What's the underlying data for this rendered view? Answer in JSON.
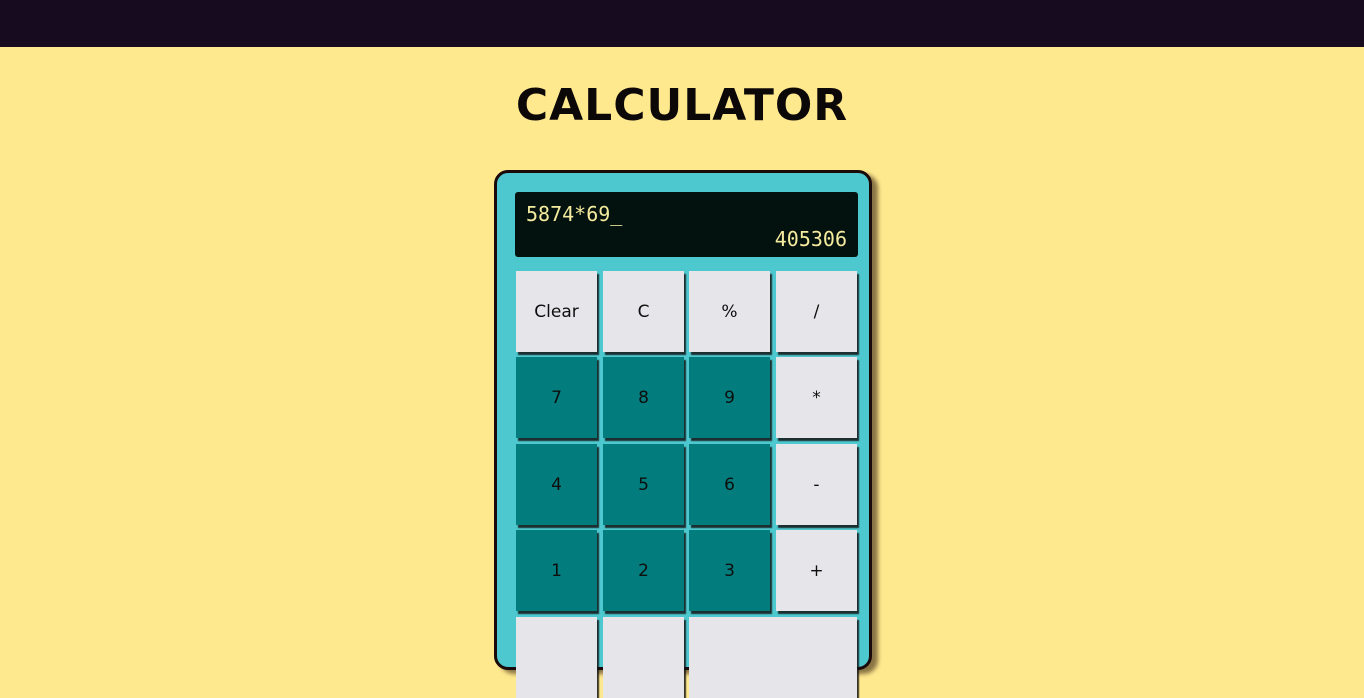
{
  "header": {
    "title": "CALCULATOR"
  },
  "display": {
    "expression": "5874*69_",
    "result": "405306"
  },
  "keys": {
    "clear": "Clear",
    "c": "C",
    "percent": "%",
    "divide": "/",
    "seven": "7",
    "eight": "8",
    "nine": "9",
    "multiply": "*",
    "four": "4",
    "five": "5",
    "six": "6",
    "minus": "-",
    "one": "1",
    "two": "2",
    "three": "3",
    "plus": "+"
  },
  "colors": {
    "background": "#ffe98e",
    "topbar": "#170c1f",
    "calculator_body": "#4ec8cf",
    "display_bg": "#04120f",
    "display_text": "#f4eb9e",
    "key_light": "#e6e6ea",
    "key_dark": "#027c7c"
  }
}
